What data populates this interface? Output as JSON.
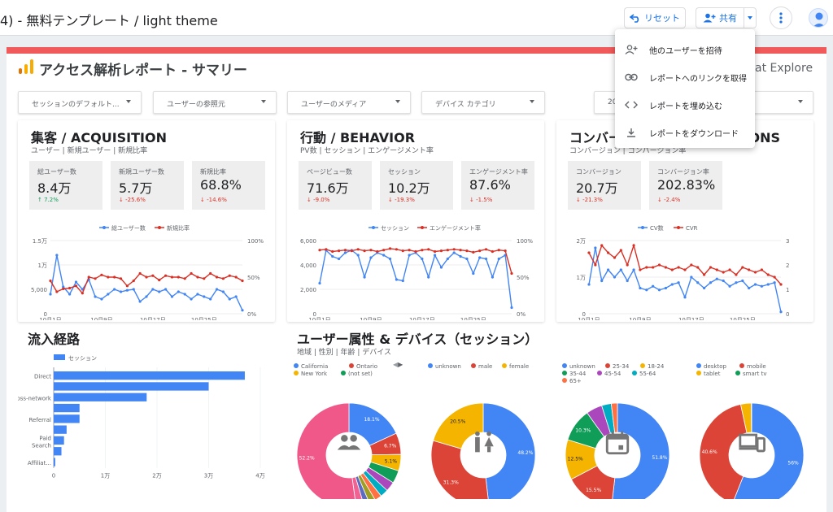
{
  "topbar": {
    "title": "4) - 無料テンプレート / light theme",
    "reset_label": "リセット",
    "share_label": "共有"
  },
  "menu": {
    "items": [
      {
        "label": "他のユーザーを招待",
        "icon": "person-add-icon"
      },
      {
        "label": "レポートへのリンクを取得",
        "icon": "link-icon"
      },
      {
        "label": "レポートを埋め込む",
        "icon": "embed-icon"
      },
      {
        "label": "レポートをダウンロード",
        "icon": "download-icon"
      }
    ]
  },
  "report": {
    "title": "アクセス解析レポート - サマリー",
    "brand": "at Explore",
    "accent": "#f05a5a",
    "filters": [
      "セッションのデフォルト...",
      "ユーザーの参照元",
      "ユーザーのメディア",
      "デバイス カテゴリ",
      "20"
    ],
    "acquisition": {
      "title": "集客 / ACQUISITION",
      "subtitle": "ユーザー | 新規ユーザー | 新規比率",
      "kpis": [
        {
          "label": "総ユーザー数",
          "value": "8.4万",
          "delta": "↑ 7.2%",
          "dir": "up"
        },
        {
          "label": "新規ユーザー数",
          "value": "5.7万",
          "delta": "↓ -25.6%",
          "dir": "down"
        },
        {
          "label": "新規比率",
          "value": "68.8%",
          "delta": "↓ -14.6%",
          "dir": "down"
        }
      ]
    },
    "behavior": {
      "title": "行動 / BEHAVIOR",
      "subtitle": "PV数 | セッション | エンゲージメント率",
      "kpis": [
        {
          "label": "ページビュー数",
          "value": "71.6万",
          "delta": "↓ -9.0%",
          "dir": "down"
        },
        {
          "label": "セッション",
          "value": "10.2万",
          "delta": "↓ -19.3%",
          "dir": "down"
        },
        {
          "label": "エンゲージメント率",
          "value": "87.6%",
          "delta": "↓ -1.5%",
          "dir": "down"
        }
      ]
    },
    "conversion": {
      "title": "コンバージョン / CONVERSIONS",
      "subtitle": "コンバージョン | コンバージョン率",
      "kpis": [
        {
          "label": "コンバージョン",
          "value": "20.7万",
          "delta": "↓ -21.3%",
          "dir": "down"
        },
        {
          "label": "コンバージョン率",
          "value": "202.83%",
          "delta": "↓ -2.4%",
          "dir": "down"
        }
      ]
    },
    "traffic": {
      "title": "流入経路"
    },
    "demographics": {
      "title": "ユーザー属性 & デバイス（セッション）",
      "subtitle": "地域 | 性別 | 年齢 | デバイス"
    }
  },
  "chart_data": [
    {
      "type": "line",
      "series": [
        {
          "name": "総ユーザー数",
          "color": "#4285f4",
          "axis": "left",
          "values": [
            4000,
            12000,
            5500,
            4000,
            6500,
            5000,
            7000,
            3500,
            3000,
            4000,
            5000,
            4500,
            4800,
            5000,
            2500,
            3500,
            5000,
            4500,
            5000,
            3500,
            4500,
            4000,
            3000,
            4000,
            3500,
            3000,
            5000,
            4500,
            3000,
            3500,
            700
          ]
        },
        {
          "name": "新規比率",
          "color": "#d93025",
          "axis": "right",
          "values": [
            45,
            30,
            34,
            35,
            38,
            28,
            50,
            48,
            53,
            50,
            50,
            48,
            38,
            45,
            55,
            50,
            52,
            46,
            52,
            50,
            50,
            48,
            55,
            50,
            48,
            55,
            50,
            48,
            52,
            50,
            45
          ]
        }
      ],
      "x_ticks": [
        "10月1日",
        "10月5日",
        "10月9日",
        "10月13日",
        "10月17日",
        "10月21日",
        "10月25日"
      ],
      "y_ticks_left": [
        "1.5万",
        "1万",
        "5,000",
        "0"
      ],
      "y_ticks_right": [
        "100%",
        "50%",
        "0%"
      ],
      "ylim_left": [
        0,
        15000
      ],
      "ylim_right": [
        0,
        100
      ],
      "legend": "top"
    },
    {
      "type": "line",
      "series": [
        {
          "name": "セッション",
          "color": "#4285f4",
          "axis": "left",
          "values": [
            2500,
            5200,
            4700,
            4500,
            5000,
            5200,
            4800,
            3000,
            4600,
            5000,
            4800,
            4500,
            2800,
            2700,
            4800,
            5000,
            4500,
            3000,
            4800,
            3800,
            4500,
            5000,
            4700,
            4500,
            3300,
            4600,
            4500,
            3000,
            4500,
            4800,
            500
          ]
        },
        {
          "name": "エンゲージメント率",
          "color": "#d93025",
          "axis": "right",
          "values": [
            87,
            88,
            85,
            86,
            87,
            86,
            88,
            86,
            87,
            85,
            87,
            89,
            88,
            86,
            87,
            85,
            87,
            88,
            85,
            86,
            87,
            88,
            87,
            86,
            84,
            86,
            88,
            85,
            87,
            86,
            55
          ]
        }
      ],
      "x_ticks": [
        "10月1日",
        "10月5日",
        "10月9日",
        "10月13日",
        "10月17日",
        "10月21日",
        "10月25日"
      ],
      "y_ticks_left": [
        "6,000",
        "4,000",
        "2,000",
        "0"
      ],
      "y_ticks_right": [
        "100%",
        "50%",
        "0%"
      ],
      "ylim_left": [
        0,
        6000
      ],
      "ylim_right": [
        0,
        100
      ],
      "legend": "top"
    },
    {
      "type": "line",
      "series": [
        {
          "name": "CV数",
          "color": "#4285f4",
          "axis": "left",
          "values": [
            8000,
            18000,
            9000,
            12000,
            10000,
            12000,
            9000,
            12000,
            7000,
            6500,
            7500,
            6500,
            7000,
            8000,
            8500,
            4500,
            10000,
            8500,
            7000,
            8500,
            9500,
            9000,
            7500,
            8500,
            9000,
            7000,
            8000,
            7500,
            8000,
            8500,
            500
          ]
        },
        {
          "name": "CVR",
          "color": "#d93025",
          "axis": "right",
          "values": [
            2.5,
            2.0,
            2.8,
            2.5,
            2.3,
            2.6,
            2.0,
            2.8,
            1.8,
            1.9,
            1.9,
            2.0,
            1.9,
            1.8,
            1.9,
            1.8,
            2.0,
            1.9,
            1.6,
            1.9,
            1.8,
            1.7,
            1.8,
            1.6,
            1.9,
            1.8,
            1.7,
            1.8,
            1.6,
            1.5,
            1.2
          ]
        }
      ],
      "x_ticks": [
        "10月1日",
        "10月5日",
        "10月9日",
        "10月13日",
        "10月17日",
        "10月21日",
        "10月25日"
      ],
      "y_ticks_left": [
        "2万",
        "1万",
        "0"
      ],
      "y_ticks_right": [
        "3",
        "2",
        "1",
        "0"
      ],
      "ylim_left": [
        0,
        20000
      ],
      "ylim_right": [
        0,
        3
      ],
      "legend": "top"
    },
    {
      "type": "bar",
      "orientation": "horizontal",
      "legend": [
        "セッション"
      ],
      "color": "#4285f4",
      "categories": [
        "Direct",
        "",
        "Cross-network",
        "",
        "Referral",
        "",
        "Paid Search",
        "",
        "Affiliat..."
      ],
      "values": [
        37000,
        30000,
        18000,
        5000,
        5000,
        2500,
        2000,
        1500,
        300
      ],
      "x_ticks": [
        "0",
        "1万",
        "2万",
        "3万",
        "4万"
      ],
      "xlim": [
        0,
        40000
      ]
    },
    {
      "type": "pie",
      "donut": true,
      "legend": [
        {
          "name": "California",
          "color": "#4285f4"
        },
        {
          "name": "Ontario",
          "color": "#db4437"
        },
        {
          "name": "New York",
          "color": "#f4b400"
        },
        {
          "name": "(not set)",
          "color": "#0f9d58"
        }
      ],
      "slices": [
        {
          "value": 18.1,
          "color": "#4285f4",
          "label": "18.1%"
        },
        {
          "value": 6.7,
          "color": "#db4437",
          "label": "6.7%"
        },
        {
          "value": 5.1,
          "color": "#f4b400",
          "label": "5.1%"
        },
        {
          "value": 4.0,
          "color": "#0f9d58",
          "label": ""
        },
        {
          "value": 3.0,
          "color": "#ab47bc",
          "label": ""
        },
        {
          "value": 2.5,
          "color": "#00acc1",
          "label": ""
        },
        {
          "value": 2.2,
          "color": "#ff7043",
          "label": ""
        },
        {
          "value": 2.0,
          "color": "#9e9d24",
          "label": ""
        },
        {
          "value": 1.8,
          "color": "#5c6bc0",
          "label": ""
        },
        {
          "value": 2.4,
          "color": "#f06292",
          "label": ""
        },
        {
          "value": 52.2,
          "color": "#f0588a",
          "label": "52.2%"
        }
      ]
    },
    {
      "type": "pie",
      "donut": true,
      "legend": [
        {
          "name": "unknown",
          "color": "#4285f4"
        },
        {
          "name": "male",
          "color": "#db4437"
        },
        {
          "name": "female",
          "color": "#f4b400"
        }
      ],
      "slices": [
        {
          "value": 48.2,
          "color": "#4285f4",
          "label": "48.2%"
        },
        {
          "value": 31.3,
          "color": "#db4437",
          "label": "31.3%"
        },
        {
          "value": 20.5,
          "color": "#f4b400",
          "label": "20.5%"
        }
      ]
    },
    {
      "type": "pie",
      "donut": true,
      "legend": [
        {
          "name": "unknown",
          "color": "#4285f4"
        },
        {
          "name": "25-34",
          "color": "#db4437"
        },
        {
          "name": "18-24",
          "color": "#f4b400"
        },
        {
          "name": "35-44",
          "color": "#0f9d58"
        },
        {
          "name": "45-54",
          "color": "#ab47bc"
        },
        {
          "name": "55-64",
          "color": "#00acc1"
        },
        {
          "name": "65+",
          "color": "#ff7043"
        }
      ],
      "slices": [
        {
          "value": 51.8,
          "color": "#4285f4",
          "label": "51.8%"
        },
        {
          "value": 15.5,
          "color": "#db4437",
          "label": "15.5%"
        },
        {
          "value": 12.5,
          "color": "#f4b400",
          "label": "12.5%"
        },
        {
          "value": 10.3,
          "color": "#0f9d58",
          "label": "10.3%"
        },
        {
          "value": 5.0,
          "color": "#ab47bc",
          "label": ""
        },
        {
          "value": 3.0,
          "color": "#00acc1",
          "label": ""
        },
        {
          "value": 1.9,
          "color": "#ff7043",
          "label": ""
        }
      ]
    },
    {
      "type": "pie",
      "donut": true,
      "legend": [
        {
          "name": "desktop",
          "color": "#4285f4"
        },
        {
          "name": "mobile",
          "color": "#db4437"
        },
        {
          "name": "tablet",
          "color": "#f4b400"
        },
        {
          "name": "smart tv",
          "color": "#0f9d58"
        }
      ],
      "slices": [
        {
          "value": 56.0,
          "color": "#4285f4",
          "label": "56%"
        },
        {
          "value": 40.6,
          "color": "#db4437",
          "label": "40.6%"
        },
        {
          "value": 3.3,
          "color": "#f4b400",
          "label": ""
        },
        {
          "value": 0.1,
          "color": "#0f9d58",
          "label": ""
        }
      ]
    }
  ]
}
